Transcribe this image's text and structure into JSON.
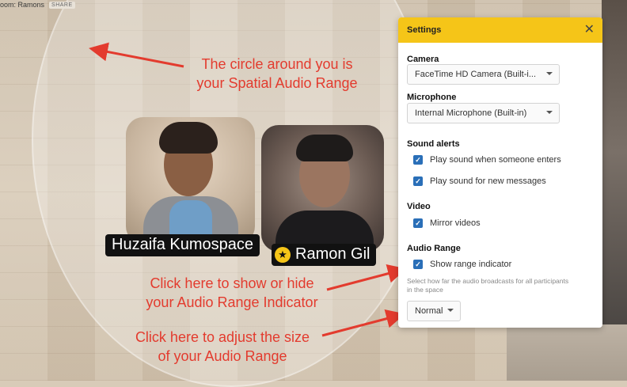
{
  "room": {
    "label": "oom: Ramons",
    "share_label": "SHARE"
  },
  "participants": [
    {
      "name": "Huzaifa Kumospace"
    },
    {
      "name": "Ramon Gil",
      "badge_icon": "star-icon"
    }
  ],
  "annotations": {
    "range_circle": [
      "The circle around you is",
      "your Spatial Audio Range"
    ],
    "show_hide": [
      "Click here to show or hide",
      "your Audio Range Indicator"
    ],
    "adjust_size": [
      "Click  here to adjust the size",
      "of your Audio Range"
    ]
  },
  "settings": {
    "title": "Settings",
    "close_icon": "close-icon",
    "camera": {
      "label": "Camera",
      "value": "FaceTime HD Camera (Built-i..."
    },
    "microphone": {
      "label": "Microphone",
      "value": "Internal Microphone (Built-in)"
    },
    "sound_alerts": {
      "label": "Sound alerts",
      "options": [
        {
          "label": "Play sound when someone enters",
          "checked": true
        },
        {
          "label": "Play sound for new messages",
          "checked": true
        }
      ]
    },
    "video": {
      "label": "Video",
      "options": [
        {
          "label": "Mirror videos",
          "checked": true
        }
      ]
    },
    "audio_range": {
      "label": "Audio Range",
      "show_indicator": {
        "label": "Show range indicator",
        "checked": true
      },
      "help": "Select how far the audio broadcasts for all participants in the space",
      "size_value": "Normal"
    }
  },
  "colors": {
    "accent": "#f5c518",
    "annotation": "#e33b2e",
    "checkbox": "#2a6fb8"
  }
}
